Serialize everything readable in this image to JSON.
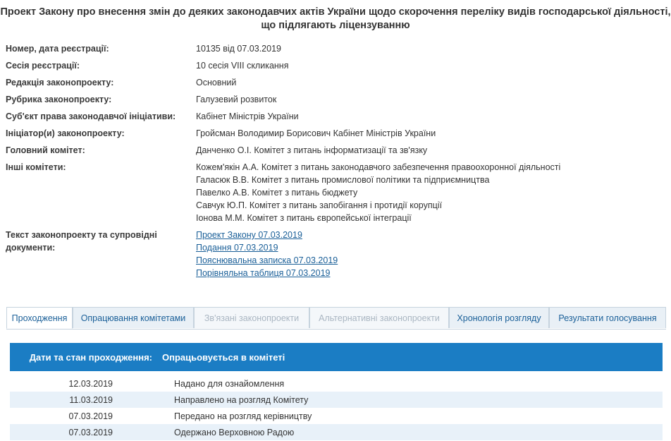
{
  "title_line1": "Проект Закону про внесення змін до деяких законодавчих актів України щодо скорочення переліку видів господарської діяльності,",
  "title_line2": "що підлягають ліцензуванню",
  "info": {
    "reg_label": "Номер, дата реєстрації:",
    "reg_value": "10135 від 07.03.2019",
    "session_label": "Сесія реєстрації:",
    "session_value": "10 сесія VIII скликання",
    "edition_label": "Редакція законопроекту:",
    "edition_value": "Основний",
    "rubric_label": "Рубрика законопроекту:",
    "rubric_value": "Галузевий розвиток",
    "subject_label": "Суб'єкт права законодавчої ініціативи:",
    "subject_value": "Кабінет Міністрів України",
    "initiator_label": "Ініціатор(и) законопроекту:",
    "initiator_value": "Гройсман Володимир Борисович Кабінет Міністрів України",
    "main_committee_label": "Головний комітет:",
    "main_committee_value": "Данченко О.І. Комітет з питань інформатизації та зв'язку",
    "other_committees_label": "Інші комітети:",
    "other_committees": [
      "Кожем'якін А.А. Комітет з питань законодавчого забезпечення правоохоронної діяльності",
      "Галасюк В.В. Комітет з питань промислової політики та підприємництва",
      "Павелко А.В. Комітет з питань бюджету",
      "Савчук Ю.П. Комітет з питань запобігання і протидії корупції",
      "Іонова М.М. Комітет з питань європейської інтеграції"
    ],
    "docs_label_line1": "Текст законопроекту та супровідні",
    "docs_label_line2": "документи:",
    "docs": [
      "Проект Закону 07.03.2019",
      "Подання 07.03.2019",
      "Пояснювальна записка 07.03.2019",
      "Порівняльна таблиця 07.03.2019"
    ]
  },
  "tabs": [
    "Проходження",
    "Опрацювання комітетами",
    "Зв'язані законопроекти",
    "Альтернативні законопроекти",
    "Хронологія розгляду",
    "Результати голосування"
  ],
  "progress": {
    "header_label": "Дати та стан проходження:",
    "header_status": "Опрацьовується в комітеті",
    "rows": [
      {
        "date": "12.03.2019",
        "status": "Надано для ознайомлення"
      },
      {
        "date": "11.03.2019",
        "status": "Направлено на розгляд Комітету"
      },
      {
        "date": "07.03.2019",
        "status": "Передано на розгляд керівництву"
      },
      {
        "date": "07.03.2019",
        "status": "Одержано Верховною Радою"
      }
    ]
  },
  "colors": {
    "header_blue": "#1b7dc4",
    "link_blue": "#1a5f98",
    "row_alt": "#e8f1f9"
  }
}
